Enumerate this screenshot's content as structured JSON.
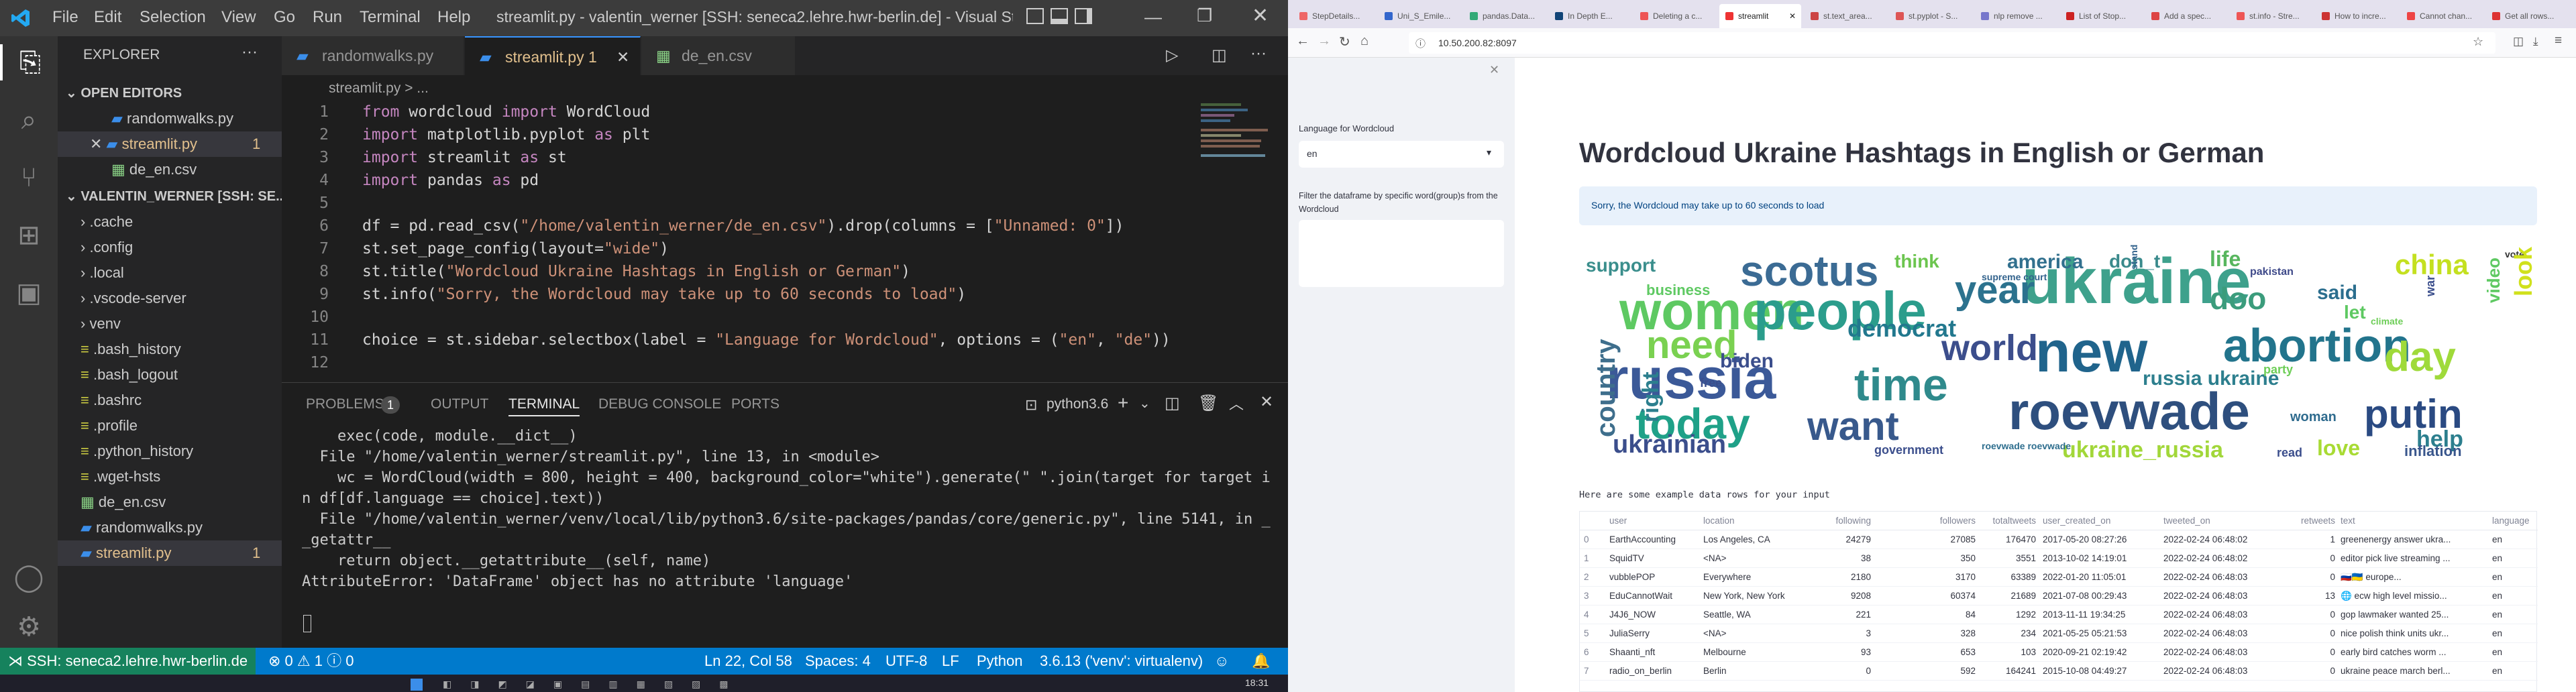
{
  "vscode": {
    "menu": [
      "File",
      "Edit",
      "Selection",
      "View",
      "Go",
      "Run",
      "Terminal",
      "Help"
    ],
    "window_title": "streamlit.py - valentin_werner [SSH: seneca2.lehre.hwr-berlin.de] - Visual Studi...",
    "explorer_title": "EXPLORER",
    "open_editors_label": "OPEN EDITORS",
    "open_editors": [
      {
        "name": "randomwalks.py",
        "badge": ""
      },
      {
        "name": "streamlit.py",
        "badge": "1"
      },
      {
        "name": "de_en.csv",
        "badge": ""
      }
    ],
    "workspace_label": "VALENTIN_WERNER [SSH: SE...",
    "folders": [
      ".cache",
      ".config",
      ".local",
      ".vscode-server",
      "venv"
    ],
    "files": [
      ".bash_history",
      ".bash_logout",
      ".bashrc",
      ".profile",
      ".python_history",
      ".wget-hsts",
      "de_en.csv",
      "randomwalks.py",
      "streamlit.py"
    ],
    "files_badge": "1",
    "tabs": [
      {
        "label": "randomwalks.py",
        "badge": ""
      },
      {
        "label": "streamlit.py 1",
        "badge": ""
      },
      {
        "label": "de_en.csv",
        "badge": ""
      }
    ],
    "breadcrumb": "streamlit.py > ...",
    "code": [
      {
        "n": "1",
        "t": "from wordcloud import WordCloud"
      },
      {
        "n": "2",
        "t": "import matplotlib.pyplot as plt"
      },
      {
        "n": "3",
        "t": "import streamlit as st"
      },
      {
        "n": "4",
        "t": "import pandas as pd"
      },
      {
        "n": "5",
        "t": ""
      },
      {
        "n": "6",
        "t": "df = pd.read_csv(\"/home/valentin_werner/de_en.csv\").drop(columns = [\"Unnamed: 0\"])"
      },
      {
        "n": "7",
        "t": "st.set_page_config(layout=\"wide\")"
      },
      {
        "n": "8",
        "t": "st.title(\"Wordcloud Ukraine Hashtags in English or German\")"
      },
      {
        "n": "9",
        "t": "st.info(\"Sorry, the Wordcloud may take up to 60 seconds to load\")"
      },
      {
        "n": "10",
        "t": ""
      },
      {
        "n": "11",
        "t": "choice = st.sidebar.selectbox(label = \"Language for Wordcloud\", options = (\"en\", \"de\"))"
      },
      {
        "n": "12",
        "t": ""
      }
    ],
    "panel_tabs": [
      "PROBLEMS",
      "OUTPUT",
      "TERMINAL",
      "DEBUG CONSOLE",
      "PORTS"
    ],
    "problems_count": "1",
    "terminal_name": "python3.6",
    "terminal": [
      "    exec(code, module.__dict__)",
      "  File \"/home/valentin_werner/streamlit.py\", line 13, in <module>",
      "    wc = WordCloud(width = 800, height = 400, background_color=\"white\").generate(\" \".join(target for target i",
      "n df[df.language == choice].text))",
      "  File \"/home/valentin_werner/venv/local/lib/python3.6/site-packages/pandas/core/generic.py\", line 5141, in _",
      "_getattr__",
      "    return object.__getattribute__(self, name)",
      "AttributeError: 'DataFrame' object has no attribute 'language'"
    ],
    "status": {
      "remote": "SSH: seneca2.lehre.hwr-berlin.de",
      "errors": "0",
      "warnings": "1",
      "info": "0",
      "position": "Ln 22, Col 58",
      "spaces": "Spaces: 4",
      "encoding": "UTF-8",
      "eol": "LF",
      "language": "Python",
      "interpreter": "3.6.13 ('venv': virtualenv)"
    },
    "taskbar_time": "18:31"
  },
  "browser": {
    "tabs": [
      "StepDetails...",
      "Uni_S_Emile...",
      "pandas.Data...",
      "In Depth E...",
      "Deleting a c...",
      "streamlit",
      "st.text_area...",
      "st.pyplot - S...",
      "nlp remove ...",
      "List of Stop...",
      "Add a spec...",
      "st.info - Stre...",
      "How to incre...",
      "Cannot chan...",
      "Get all rows..."
    ],
    "active_tab": 5,
    "url": "10.50.200.82:8097",
    "sidebar": {
      "select_label": "Language for Wordcloud",
      "select_value": "en",
      "filter_label": "Filter the dataframe by specific word(group)s from the Wordcloud"
    },
    "title": "Wordcloud Ukraine Hashtags in English or German",
    "info": "Sorry, the Wordcloud may take up to 60 seconds to load",
    "table_caption": "Here are some example data rows for your input",
    "columns": [
      "",
      "user",
      "location",
      "following",
      "followers",
      "totaltweets",
      "user_created_on",
      "tweeted_on",
      "retweets",
      "text",
      "language"
    ],
    "rows": [
      [
        "0",
        "EarthAccounting",
        "Los Angeles, CA",
        "24279",
        "27085",
        "176470",
        "2017-05-20 08:27:26",
        "2022-02-24 06:48:02",
        "1",
        "greenenergy answer ukra...",
        "en"
      ],
      [
        "1",
        "SquidTV",
        "<NA>",
        "38",
        "350",
        "3551",
        "2013-10-02 14:19:01",
        "2022-02-24 06:48:02",
        "0",
        "editor pick live streaming ...",
        "en"
      ],
      [
        "2",
        "vubblePOP",
        "Everywhere",
        "2180",
        "3170",
        "63389",
        "2022-01-20 11:05:01",
        "2022-02-24 06:48:03",
        "0",
        "🇷🇺🇺🇦 europe...",
        "en"
      ],
      [
        "3",
        "EduCannotWait",
        "New York, New York",
        "9208",
        "60374",
        "21689",
        "2021-07-08 00:29:43",
        "2022-02-24 06:48:03",
        "13",
        "🌐 ecw high level missio...",
        "en"
      ],
      [
        "4",
        "J4J6_NOW",
        "Seattle, WA",
        "221",
        "84",
        "1292",
        "2013-11-11 19:34:25",
        "2022-02-24 06:48:03",
        "0",
        "gop lawmaker wanted 25...",
        "en"
      ],
      [
        "5",
        "JuliaSerry",
        "<NA>",
        "3",
        "328",
        "234",
        "2021-05-25 05:21:53",
        "2022-02-24 06:48:03",
        "0",
        "nice polish think units ukr...",
        "en"
      ],
      [
        "6",
        "Shaanti_nft",
        "Melbourne",
        "93",
        "653",
        "103",
        "2020-09-21 02:19:42",
        "2022-02-24 06:48:03",
        "0",
        "early bird catches worm ...",
        "en"
      ],
      [
        "7",
        "radio_on_berlin",
        "Berlin",
        "0",
        "592",
        "164241",
        "2015-10-08 04:49:27",
        "2022-02-24 06:48:03",
        "0",
        "ukraine peace march berl...",
        "en"
      ]
    ],
    "wordcloud_words": [
      "ukraine",
      "new",
      "russia",
      "women",
      "people",
      "roevwade",
      "abortion",
      "scotus",
      "today",
      "want",
      "world",
      "need",
      "time",
      "putin",
      "year",
      "day",
      "democrat",
      "doo",
      "china",
      "america",
      "life",
      "think",
      "support",
      "ukrainian",
      "ukraine_russia",
      "country",
      "right",
      "help",
      "said",
      "biden",
      "vote",
      "russia ukraine",
      "don_t",
      "supreme court",
      "stand with ukraine",
      "business",
      "government",
      "roevwade roevwade",
      "love",
      "look",
      "let",
      "video",
      "inflation",
      "read",
      "free",
      "party",
      "woman",
      "pakistan",
      "war",
      "climate"
    ]
  }
}
